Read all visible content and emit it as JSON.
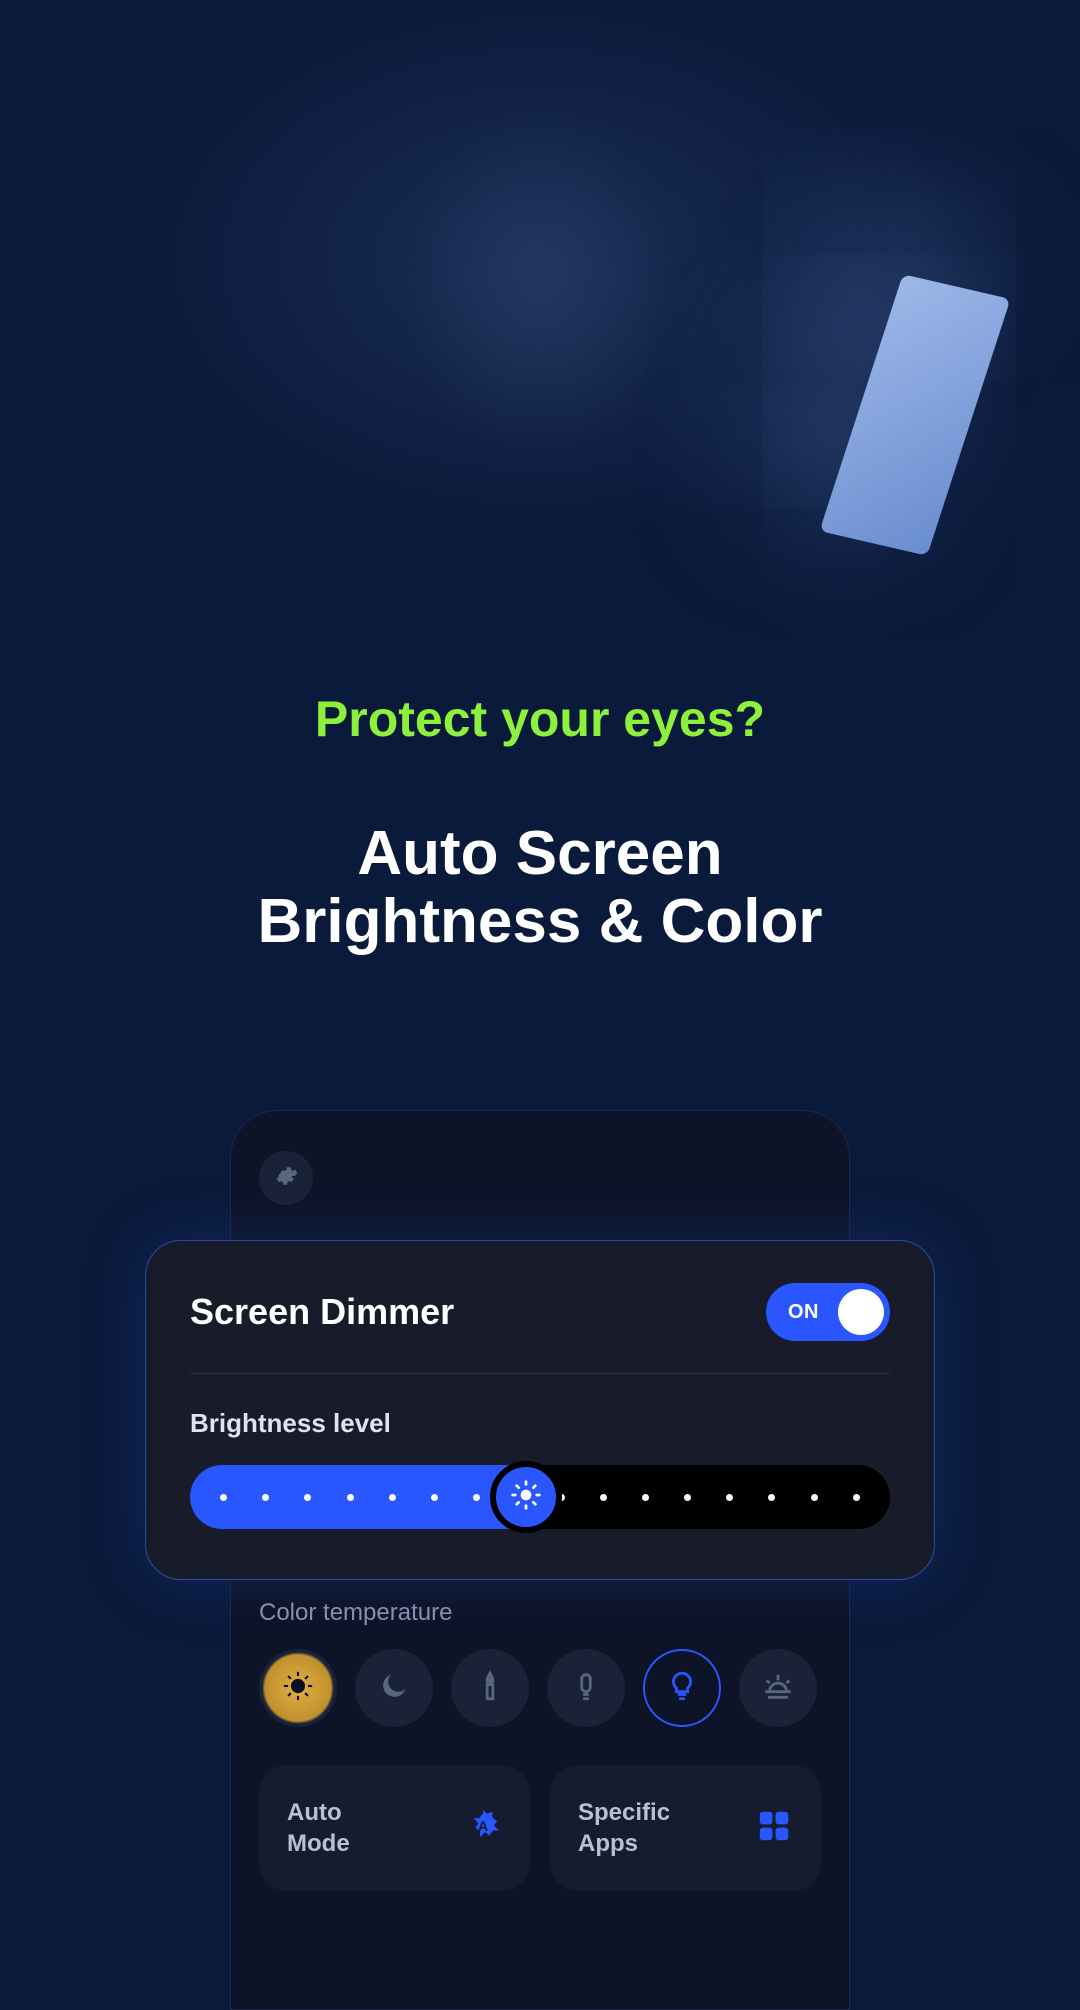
{
  "hero": {
    "accent": "Protect your eyes?",
    "main_line1": "Auto Screen",
    "main_line2": "Brightness & Color"
  },
  "dimmer": {
    "title": "Screen Dimmer",
    "toggle_label": "ON",
    "brightness_label": "Brightness level",
    "slider_dots": 16,
    "slider_value_percent": 50
  },
  "temperature": {
    "label": "Color temperature",
    "options": [
      {
        "name": "eye-comfort",
        "selected": true
      },
      {
        "name": "moon"
      },
      {
        "name": "candle"
      },
      {
        "name": "fluorescent"
      },
      {
        "name": "bulb",
        "outlined": true
      },
      {
        "name": "sunrise"
      }
    ]
  },
  "modes": {
    "auto": {
      "line1": "Auto",
      "line2": "Mode"
    },
    "specific": {
      "line1": "Specific",
      "line2": "Apps"
    }
  },
  "colors": {
    "accent_green": "#8cf03c",
    "accent_blue": "#2a56ff",
    "bg_dark": "#0a1a3a"
  }
}
